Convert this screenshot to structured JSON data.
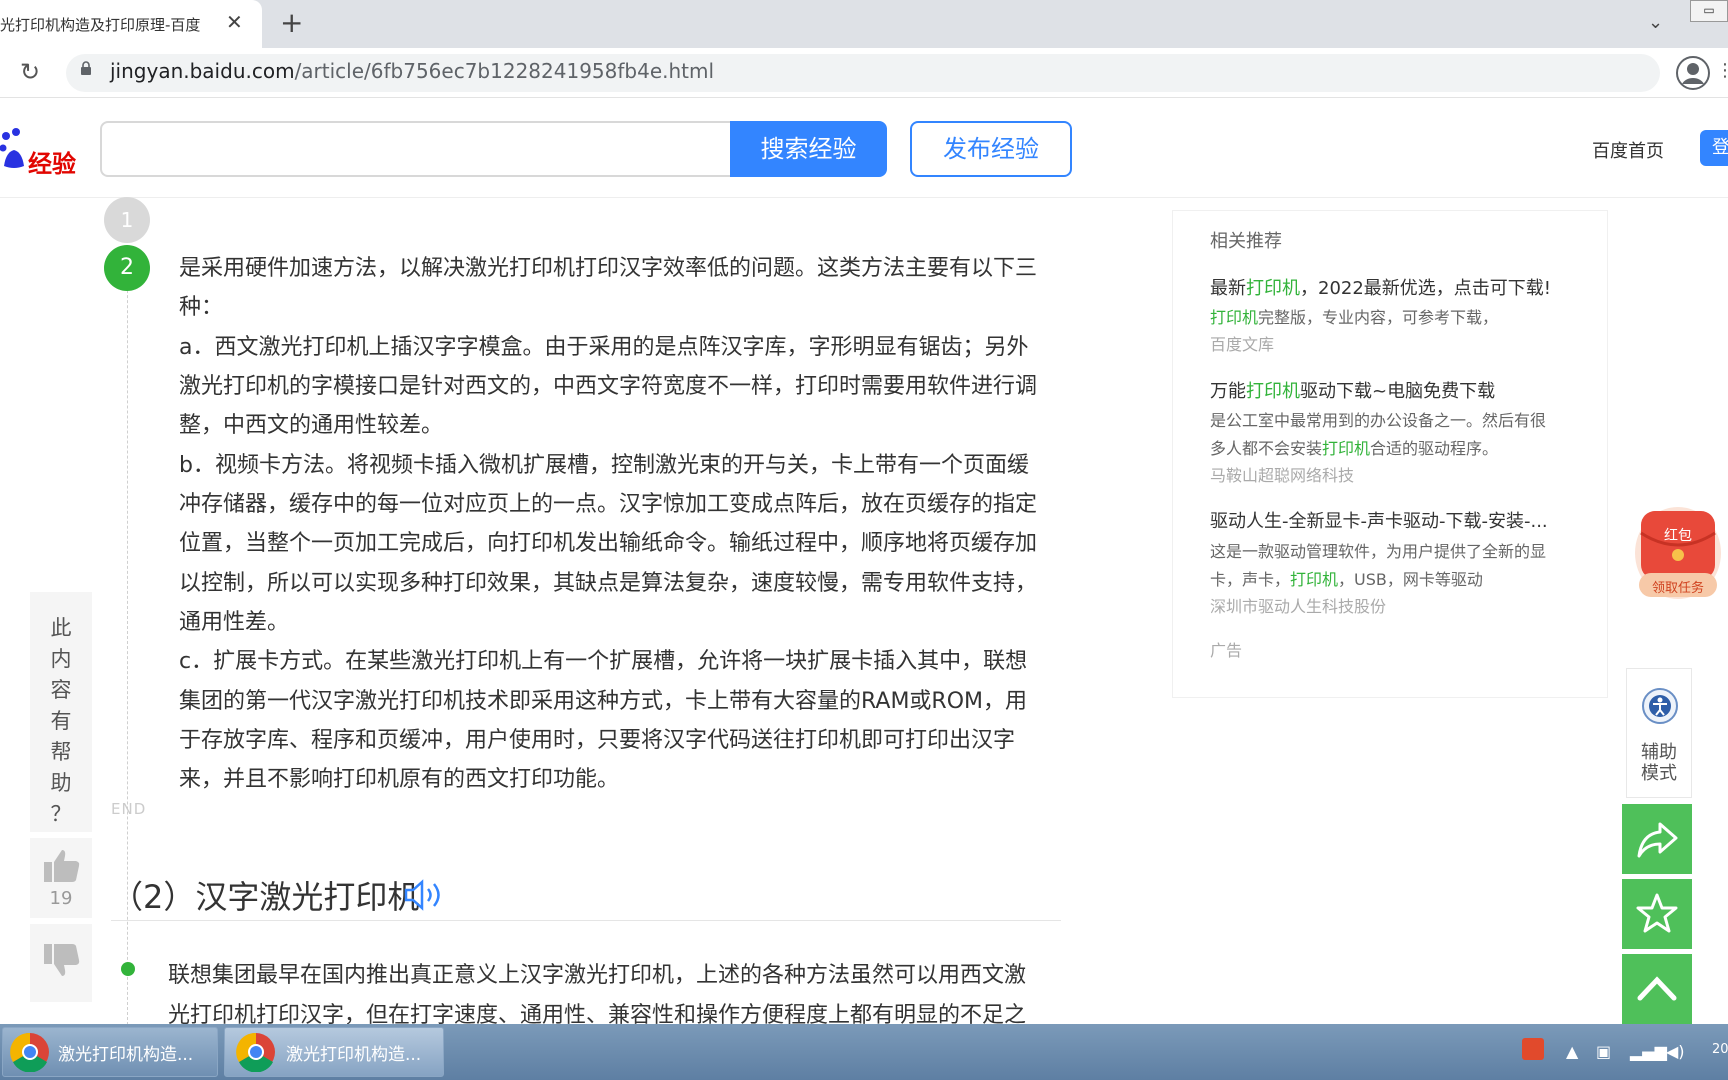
{
  "browser": {
    "tab_title": "光打印机构造及打印原理-百度",
    "new_tab_symbol": "+",
    "close_symbol": "✕",
    "url_host": "jingyan.baidu.com",
    "url_path": "/article/6fb756ec7b1228241958fb4e.html"
  },
  "header": {
    "logo_text": "经验",
    "search_button": "搜索经验",
    "publish_button": "发布经验",
    "home_link": "百度首页",
    "login_button": "登"
  },
  "article": {
    "step1_number": "1",
    "step2_number": "2",
    "lines": [
      "是采用硬件加速方法，以解决激光打印机打印汉字效率低的问题。这类方法主要有以下三",
      "种：",
      "a．西文激光打印机上插汉字字模盒。由于采用的是点阵汉字库，字形明显有锯齿；另外",
      "激光打印机的字模接口是针对西文的，中西文字符宽度不一样，打印时需要用软件进行调",
      "整，中西文的通用性较差。",
      "b．视频卡方法。将视频卡插入微机扩展槽，控制激光束的开与关，卡上带有一个页面缓",
      "冲存储器，缓存中的每一位对应页上的一点。汉字惊加工变成点阵后，放在页缓存的指定",
      "位置，当整个一页加工完成后，向打印机发出输纸命令。输纸过程中，顺序地将页缓存加",
      "以控制，所以可以实现多种打印效果，其缺点是算法复杂，速度较慢，需专用软件支持，",
      "通用性差。",
      "c．扩展卡方式。在某些激光打印机上有一个扩展槽，允许将一块扩展卡插入其中，联想",
      "集团的第一代汉字激光打印机技术即采用这种方式，卡上带有大容量的RAM或ROM，用",
      "于存放字库、程序和页缓冲，用户使用时，只要将汉字代码送往打印机即可打印出汉字",
      "来，并且不影响打印机原有的西文打印功能。"
    ],
    "end_mark": "END",
    "section_heading": "（2）汉字激光打印机",
    "next_lines": [
      "联想集团最早在国内推出真正意义上汉字激光打印机，上述的各种方法虽然可以用西文激",
      "光打印机打印汉字，但在打字速度、通用性、兼容性和操作方便程度上都有明显的不足之"
    ]
  },
  "feedback": {
    "chars": [
      "此",
      "内",
      "容",
      "有",
      "帮",
      "助",
      "？"
    ],
    "like_count": "19"
  },
  "sidebar": {
    "heading": "相关推荐",
    "items": [
      {
        "title_pre": "最新",
        "title_hl": "打印机",
        "title_post": "，2022最新优选，点击可下载!",
        "desc1_hl": "打印机",
        "desc1_post": "完整版，专业内容，可参考下载，",
        "source": "百度文库"
      },
      {
        "title_pre": "万能",
        "title_hl": "打印机",
        "title_post": "驱动下载~电脑免费下载",
        "desc1": "是公工室中最常用到的办公设备之一。然后有很",
        "desc2_pre": "多人都不会安装",
        "desc2_hl": "打印机",
        "desc2_post": "合适的驱动程序。",
        "source": "马鞍山超聪网络科技"
      },
      {
        "title": "驱动人生-全新显卡-声卡驱动-下载-安装-...",
        "desc1": "这是一款驱动管理软件，为用户提供了全新的显",
        "desc2_pre": "卡，声卡，",
        "desc2_hl": "打印机",
        "desc2_post": "，USB，网卡等驱动",
        "source": "深圳市驱动人生科技股份"
      }
    ],
    "ad_label": "广告"
  },
  "floating": {
    "redpacket_top": "红包",
    "redpacket_bottom": "领取任务",
    "assist_label_1": "辅助",
    "assist_label_2": "模式"
  },
  "taskbar": {
    "items": [
      "激光打印机构造...",
      "激光打印机构造..."
    ],
    "clock": "20"
  },
  "colors": {
    "accent_blue": "#3385ff",
    "step_green": "#32b33a",
    "float_green": "#4fc05a",
    "logo_red": "#e10601"
  }
}
